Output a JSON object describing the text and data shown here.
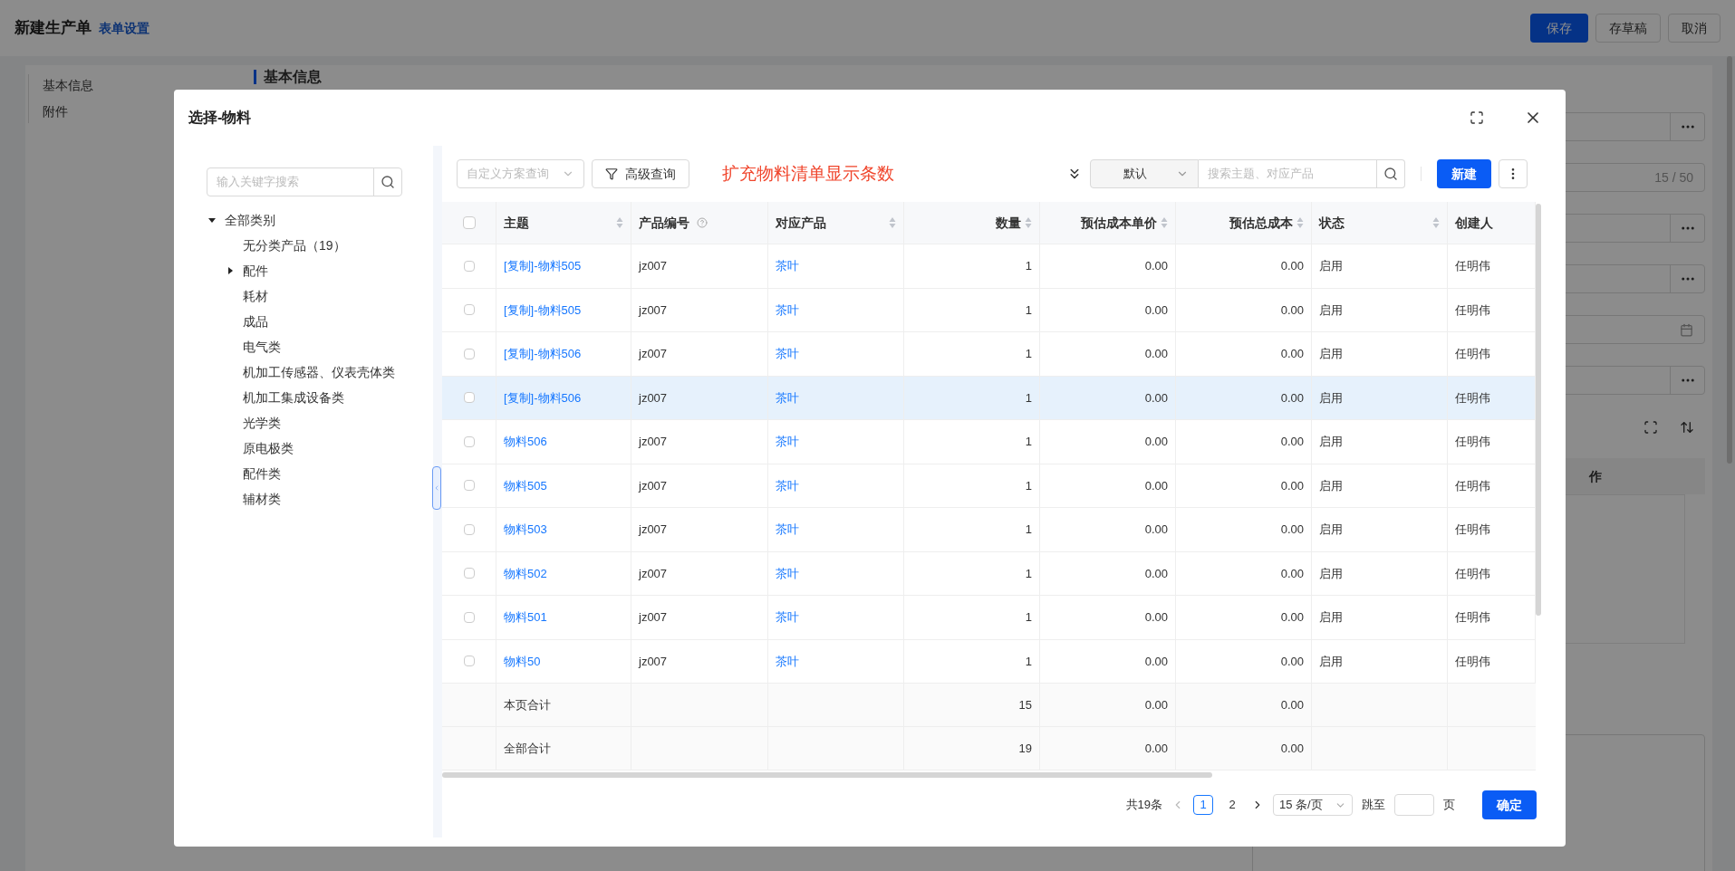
{
  "page": {
    "title": "新建生产单",
    "settings_link": "表单设置",
    "actions": [
      {
        "label": "保存",
        "kind": "primary"
      },
      {
        "label": "存草稿",
        "kind": "default"
      },
      {
        "label": "取消",
        "kind": "default"
      }
    ],
    "side_nav": [
      "基本信息",
      "附件"
    ],
    "section_title": "基本信息",
    "fields": [
      {
        "kind": "picker"
      },
      {
        "kind": "counter",
        "count": "15 / 50"
      },
      {
        "kind": "picker"
      },
      {
        "kind": "picker"
      },
      {
        "kind": "date"
      },
      {
        "kind": "picker"
      }
    ],
    "table_header_fragment": "作"
  },
  "dialog": {
    "title": "选择-物料",
    "tree_search": {
      "placeholder": "输入关键字搜索"
    },
    "tree": [
      {
        "label": "全部类别",
        "kind": "branch",
        "expanded": true,
        "children": [
          {
            "label": "无分类产品（19）",
            "kind": "leaf"
          },
          {
            "label": "配件",
            "kind": "branch",
            "expanded": false
          },
          {
            "label": "耗材",
            "kind": "leaf"
          },
          {
            "label": "成品",
            "kind": "leaf"
          },
          {
            "label": "电气类",
            "kind": "leaf"
          },
          {
            "label": "机加工传感器、仪表壳体类",
            "kind": "leaf"
          },
          {
            "label": "机加工集成设备类",
            "kind": "leaf"
          },
          {
            "label": "光学类",
            "kind": "leaf"
          },
          {
            "label": "原电极类",
            "kind": "leaf"
          },
          {
            "label": "配件类",
            "kind": "leaf"
          },
          {
            "label": "辅材类",
            "kind": "leaf"
          }
        ]
      }
    ],
    "toolbar": {
      "scheme_select": {
        "placeholder": "自定义方案查询"
      },
      "advanced_button": "高级查询",
      "note": "扩充物料清单显示条数",
      "sort_select": {
        "value": "默认"
      },
      "search": {
        "placeholder": "搜索主题、对应产品"
      },
      "new_button": "新建"
    },
    "table": {
      "select_all": {
        "checked": false
      },
      "columns": [
        {
          "label": "主题",
          "kind": "link",
          "sortable": true,
          "help": false
        },
        {
          "label": "产品编号",
          "kind": "text",
          "sortable": false,
          "help": true
        },
        {
          "label": "对应产品",
          "kind": "link",
          "sortable": true,
          "help": false
        },
        {
          "label": "数量",
          "kind": "number",
          "sortable": true,
          "help": false
        },
        {
          "label": "预估成本单价",
          "kind": "number",
          "sortable": true,
          "help": false
        },
        {
          "label": "预估总成本",
          "kind": "number",
          "sortable": true,
          "help": false
        },
        {
          "label": "状态",
          "kind": "text",
          "sortable": true,
          "help": false
        },
        {
          "label": "创建人",
          "kind": "text",
          "sortable": false,
          "help": false
        }
      ],
      "rows": [
        {
          "checked": false,
          "highlighted": false,
          "cells": [
            "[复制]-物料505",
            "jz007",
            "茶叶",
            "1",
            "0.00",
            "0.00",
            "启用",
            "任明伟"
          ]
        },
        {
          "checked": false,
          "highlighted": false,
          "cells": [
            "[复制]-物料505",
            "jz007",
            "茶叶",
            "1",
            "0.00",
            "0.00",
            "启用",
            "任明伟"
          ]
        },
        {
          "checked": false,
          "highlighted": false,
          "cells": [
            "[复制]-物料506",
            "jz007",
            "茶叶",
            "1",
            "0.00",
            "0.00",
            "启用",
            "任明伟"
          ]
        },
        {
          "checked": false,
          "highlighted": true,
          "cells": [
            "[复制]-物料506",
            "jz007",
            "茶叶",
            "1",
            "0.00",
            "0.00",
            "启用",
            "任明伟"
          ]
        },
        {
          "checked": false,
          "highlighted": false,
          "cells": [
            "物料506",
            "jz007",
            "茶叶",
            "1",
            "0.00",
            "0.00",
            "启用",
            "任明伟"
          ]
        },
        {
          "checked": false,
          "highlighted": false,
          "cells": [
            "物料505",
            "jz007",
            "茶叶",
            "1",
            "0.00",
            "0.00",
            "启用",
            "任明伟"
          ]
        },
        {
          "checked": false,
          "highlighted": false,
          "cells": [
            "物料503",
            "jz007",
            "茶叶",
            "1",
            "0.00",
            "0.00",
            "启用",
            "任明伟"
          ]
        },
        {
          "checked": false,
          "highlighted": false,
          "cells": [
            "物料502",
            "jz007",
            "茶叶",
            "1",
            "0.00",
            "0.00",
            "启用",
            "任明伟"
          ]
        },
        {
          "checked": false,
          "highlighted": false,
          "cells": [
            "物料501",
            "jz007",
            "茶叶",
            "1",
            "0.00",
            "0.00",
            "启用",
            "任明伟"
          ]
        },
        {
          "checked": false,
          "highlighted": false,
          "cells": [
            "物料50",
            "jz007",
            "茶叶",
            "1",
            "0.00",
            "0.00",
            "启用",
            "任明伟"
          ]
        }
      ],
      "summaries": [
        {
          "label": "本页合计",
          "quantity": "15",
          "unit_cost": "0.00",
          "total_cost": "0.00"
        },
        {
          "label": "全部合计",
          "quantity": "19",
          "unit_cost": "0.00",
          "total_cost": "0.00"
        }
      ]
    },
    "pagination": {
      "total": "共19条",
      "pages": [
        {
          "label": "1",
          "selected": true
        },
        {
          "label": "2",
          "selected": false
        }
      ],
      "page_size": "15 条/页",
      "jump_label": "跳至",
      "page_suffix": "页",
      "confirm": "确定"
    }
  }
}
